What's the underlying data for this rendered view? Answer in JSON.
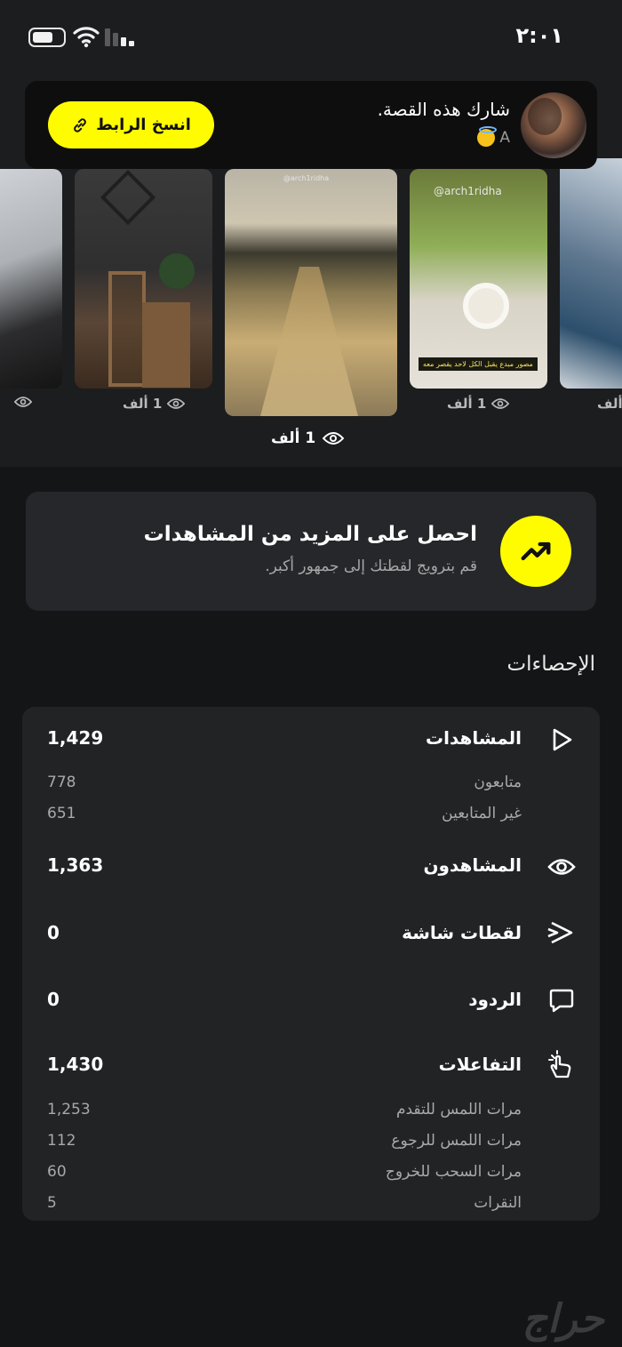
{
  "status_bar": {
    "time": "٢:٠١"
  },
  "share_card": {
    "title": "شارك هذه القصة.",
    "subtitle": "A",
    "copy_button_label": "انسخ الرابط"
  },
  "thumbnails": [
    {
      "views": "",
      "watermark": "",
      "caption": ""
    },
    {
      "views": "1 ألف",
      "watermark": "",
      "caption": ""
    },
    {
      "views": "1 ألف",
      "watermark": "@arch1ridha",
      "caption": ""
    },
    {
      "views": "1 ألف",
      "watermark": "@arch1ridha",
      "caption": "مصور مبدع يقبل الكل لاحد يقصر معه"
    },
    {
      "views": "ألف",
      "watermark": "",
      "caption": ""
    }
  ],
  "promo": {
    "title": "احصل على المزيد من المشاهدات",
    "subtitle": "قم بترويج لقطتك إلى جمهور أكبر."
  },
  "stats_section": {
    "title": "الإحصاءات",
    "rows": [
      {
        "icon": "play-icon",
        "label": "المشاهدات",
        "value": "1,429",
        "sub": [
          {
            "label": "متابعون",
            "value": "778"
          },
          {
            "label": "غير المتابعين",
            "value": "651"
          }
        ]
      },
      {
        "icon": "eye-icon",
        "label": "المشاهدون",
        "value": "1,363",
        "sub": []
      },
      {
        "icon": "screenshot-icon",
        "label": "لقطات شاشة",
        "value": "0",
        "sub": []
      },
      {
        "icon": "reply-icon",
        "label": "الردود",
        "value": "0",
        "sub": []
      },
      {
        "icon": "interaction-icon",
        "label": "التفاعلات",
        "value": "1,430",
        "sub": [
          {
            "label": "مرات اللمس للتقدم",
            "value": "1,253"
          },
          {
            "label": "مرات اللمس للرجوع",
            "value": "112"
          },
          {
            "label": "مرات السحب للخروج",
            "value": "60"
          },
          {
            "label": "النقرات",
            "value": "5"
          }
        ]
      }
    ]
  },
  "watermark": "حراج",
  "colors": {
    "accent": "#fffc00",
    "background": "#141516",
    "card": "#222325"
  }
}
